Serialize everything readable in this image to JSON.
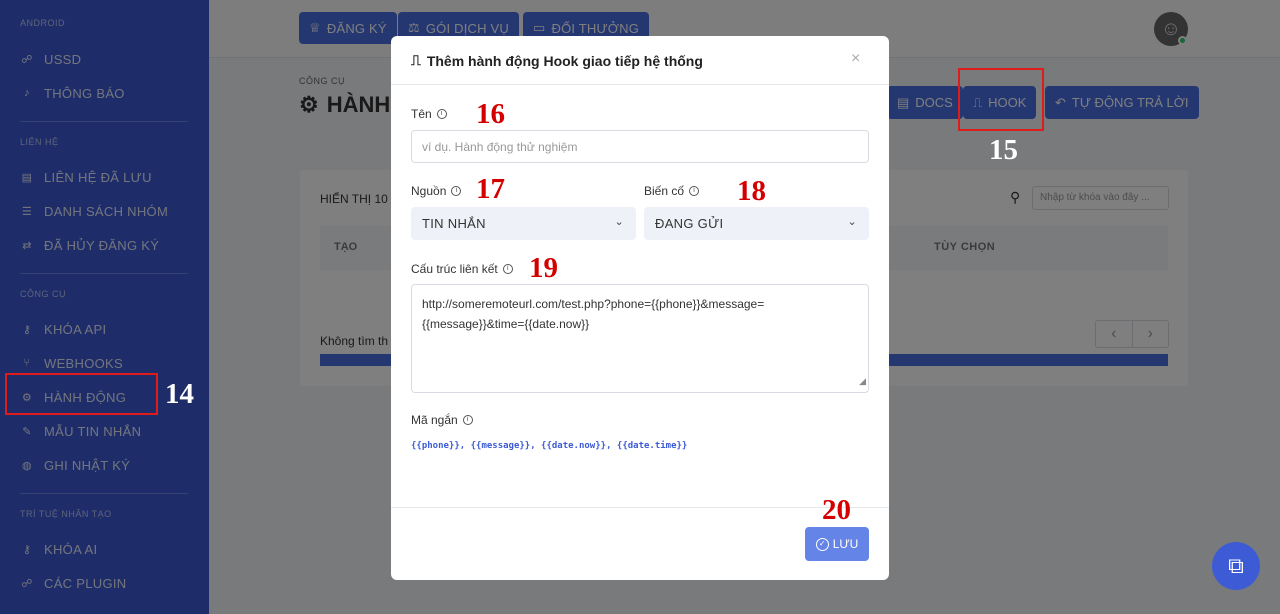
{
  "sidebar": {
    "sections": {
      "android": "ANDROID",
      "contacts": "LIÊN HỆ",
      "tools": "CÔNG CỤ",
      "ai": "TRÍ TUỆ NHÂN TẠO"
    },
    "items": {
      "ussd": "USSD",
      "notifications": "THÔNG BÁO",
      "saved_contacts": "LIÊN HỆ ĐÃ LƯU",
      "group_list": "DANH SÁCH NHÓM",
      "unsubscribed": "ĐÃ HỦY ĐĂNG KÝ",
      "api_keys": "KHÓA API",
      "webhooks": "WEBHOOKS",
      "actions": "HÀNH ĐỘNG",
      "templates": "MẪU TIN NHẮN",
      "logs": "GHI NHẬT KÝ",
      "ai_keys": "KHÓA AI",
      "plugins": "CÁC PLUGIN"
    }
  },
  "topbar": {
    "register": "ĐĂNG KÝ",
    "packages": "GÓI DỊCH VỤ",
    "rewards": "ĐỔI THƯỞNG"
  },
  "page": {
    "breadcrumb": "CÔNG CỤ",
    "title": "HÀNH",
    "docs": "DOCS",
    "hook": "HOOK",
    "auto_reply": "TỰ ĐỘNG TRẢ LỜI",
    "show": "HIỂN THỊ",
    "show_value": "10",
    "search_placeholder": "Nhập từ khóa vào đây ...",
    "col_created": "TẠO",
    "col_options": "TÙY CHỌN",
    "no_results": "Không tìm th"
  },
  "modal": {
    "title": "Thêm hành động Hook giao tiếp hệ thống",
    "close": "×",
    "name_label": "Tên",
    "name_placeholder": "ví dụ. Hành động thử nghiệm",
    "source_label": "Nguồn",
    "source_value": "TIN NHẮN",
    "event_label": "Biến cố",
    "event_value": "ĐANG GỬI",
    "link_label": "Cấu trúc liên kết",
    "link_value_line1": "http://someremoteurl.com/test.php?phone={{phone}}&message=",
    "link_value_line2": "{{message}}&time={{date.now}}",
    "shortcode_label": "Mã ngắn",
    "shortcodes": "{{phone}}, {{message}}, {{date.now}}, {{date.time}}",
    "save": "LƯU"
  },
  "annotations": {
    "n14": "14",
    "n15": "15",
    "n16": "16",
    "n17": "17",
    "n18": "18",
    "n19": "19",
    "n20": "20"
  },
  "colors": {
    "primary": "#4b6fe3",
    "sidebar": "#3d5bd4",
    "annotation_red": "#d40000"
  }
}
